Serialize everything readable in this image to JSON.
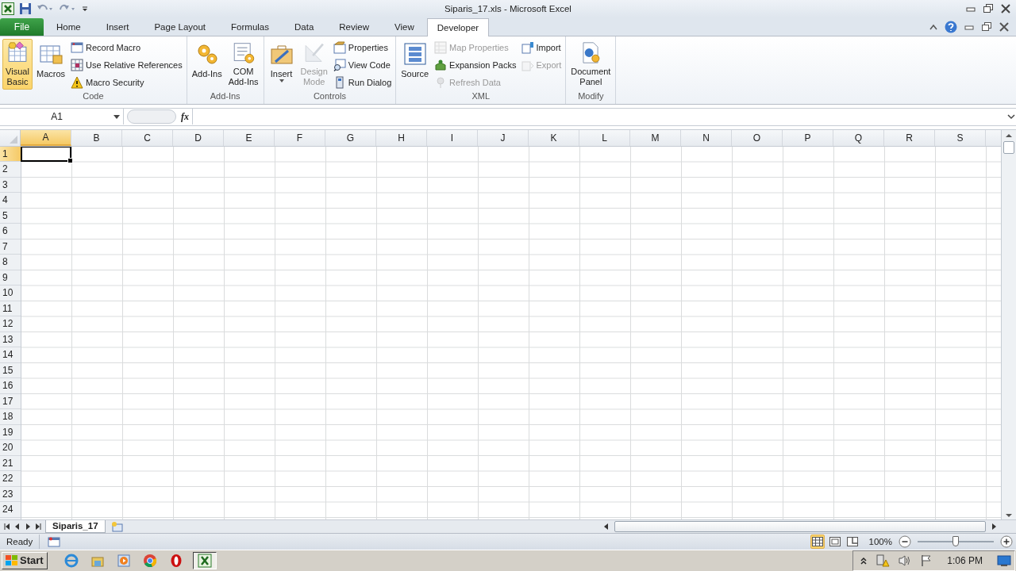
{
  "title": "Siparis_17.xls - Microsoft Excel",
  "tabs": [
    {
      "label": "File",
      "kind": "file",
      "selected": false
    },
    {
      "label": "Home",
      "kind": "tab",
      "selected": false
    },
    {
      "label": "Insert",
      "kind": "tab",
      "selected": false
    },
    {
      "label": "Page Layout",
      "kind": "tab",
      "selected": false
    },
    {
      "label": "Formulas",
      "kind": "tab",
      "selected": false
    },
    {
      "label": "Data",
      "kind": "tab",
      "selected": false
    },
    {
      "label": "Review",
      "kind": "tab",
      "selected": false
    },
    {
      "label": "View",
      "kind": "tab",
      "selected": false
    },
    {
      "label": "Developer",
      "kind": "tab",
      "selected": true
    }
  ],
  "ribbon_groups": [
    {
      "label": "Code",
      "columns": [
        {
          "kind": "large",
          "label": "Visual Basic",
          "selected": true,
          "disabled": false,
          "dropdown": false
        },
        {
          "kind": "large",
          "label": "Macros",
          "selected": false,
          "disabled": false,
          "dropdown": false
        },
        {
          "kind": "stack",
          "items": [
            {
              "label": "Record Macro",
              "disabled": false
            },
            {
              "label": "Use Relative References",
              "disabled": false
            },
            {
              "label": "Macro Security",
              "disabled": false
            }
          ]
        }
      ]
    },
    {
      "label": "Add-Ins",
      "columns": [
        {
          "kind": "large",
          "label": "Add-Ins",
          "selected": false,
          "disabled": false,
          "dropdown": false
        },
        {
          "kind": "large",
          "label": "COM Add-Ins",
          "selected": false,
          "disabled": false,
          "dropdown": false
        }
      ]
    },
    {
      "label": "Controls",
      "columns": [
        {
          "kind": "large",
          "label": "Insert",
          "selected": false,
          "disabled": false,
          "dropdown": true
        },
        {
          "kind": "large",
          "label": "Design Mode",
          "selected": false,
          "disabled": true,
          "dropdown": false
        },
        {
          "kind": "stack",
          "items": [
            {
              "label": "Properties",
              "disabled": false
            },
            {
              "label": "View Code",
              "disabled": false
            },
            {
              "label": "Run Dialog",
              "disabled": false
            }
          ]
        }
      ]
    },
    {
      "label": "XML",
      "columns": [
        {
          "kind": "large",
          "label": "Source",
          "selected": false,
          "disabled": false,
          "dropdown": false
        },
        {
          "kind": "stack",
          "items": [
            {
              "label": "Map Properties",
              "disabled": true
            },
            {
              "label": "Expansion Packs",
              "disabled": false
            },
            {
              "label": "Refresh Data",
              "disabled": true
            }
          ]
        },
        {
          "kind": "stack",
          "items": [
            {
              "label": "Import",
              "disabled": false
            },
            {
              "label": "Export",
              "disabled": true
            }
          ]
        }
      ]
    },
    {
      "label": "Modify",
      "columns": [
        {
          "kind": "large",
          "label": "Document Panel",
          "selected": false,
          "disabled": false,
          "dropdown": false
        }
      ]
    }
  ],
  "formula_bar": {
    "name_box": "A1",
    "function_label": "fx"
  },
  "columns": [
    {
      "label": "A",
      "selected": true
    },
    {
      "label": "B",
      "selected": false
    },
    {
      "label": "C",
      "selected": false
    },
    {
      "label": "D",
      "selected": false
    },
    {
      "label": "E",
      "selected": false
    },
    {
      "label": "F",
      "selected": false
    },
    {
      "label": "G",
      "selected": false
    },
    {
      "label": "H",
      "selected": false
    },
    {
      "label": "I",
      "selected": false
    },
    {
      "label": "J",
      "selected": false
    },
    {
      "label": "K",
      "selected": false
    },
    {
      "label": "L",
      "selected": false
    },
    {
      "label": "M",
      "selected": false
    },
    {
      "label": "N",
      "selected": false
    },
    {
      "label": "O",
      "selected": false
    },
    {
      "label": "P",
      "selected": false
    },
    {
      "label": "Q",
      "selected": false
    },
    {
      "label": "R",
      "selected": false
    },
    {
      "label": "S",
      "selected": false
    }
  ],
  "rows": [
    {
      "label": "1",
      "selected": true
    },
    {
      "label": "2",
      "selected": false
    },
    {
      "label": "3",
      "selected": false
    },
    {
      "label": "4",
      "selected": false
    },
    {
      "label": "5",
      "selected": false
    },
    {
      "label": "6",
      "selected": false
    },
    {
      "label": "7",
      "selected": false
    },
    {
      "label": "8",
      "selected": false
    },
    {
      "label": "9",
      "selected": false
    },
    {
      "label": "10",
      "selected": false
    },
    {
      "label": "11",
      "selected": false
    },
    {
      "label": "12",
      "selected": false
    },
    {
      "label": "13",
      "selected": false
    },
    {
      "label": "14",
      "selected": false
    },
    {
      "label": "15",
      "selected": false
    },
    {
      "label": "16",
      "selected": false
    },
    {
      "label": "17",
      "selected": false
    },
    {
      "label": "18",
      "selected": false
    },
    {
      "label": "19",
      "selected": false
    },
    {
      "label": "20",
      "selected": false
    },
    {
      "label": "21",
      "selected": false
    },
    {
      "label": "22",
      "selected": false
    },
    {
      "label": "23",
      "selected": false
    },
    {
      "label": "24",
      "selected": false
    }
  ],
  "sheet_tabs": [
    {
      "label": "Siparis_17",
      "selected": true
    }
  ],
  "status_bar": {
    "text": "Ready",
    "views": [
      {
        "selected": true
      },
      {
        "selected": false
      },
      {
        "selected": false
      }
    ],
    "zoom": "100%",
    "zoom_slider": {
      "level": 0.5
    }
  },
  "taskbar": {
    "start": "Start",
    "apps": [
      {
        "selected": false
      },
      {
        "selected": false
      },
      {
        "selected": false
      },
      {
        "selected": false
      },
      {
        "selected": false
      },
      {
        "selected": true
      }
    ],
    "clock": "1:06 PM"
  }
}
